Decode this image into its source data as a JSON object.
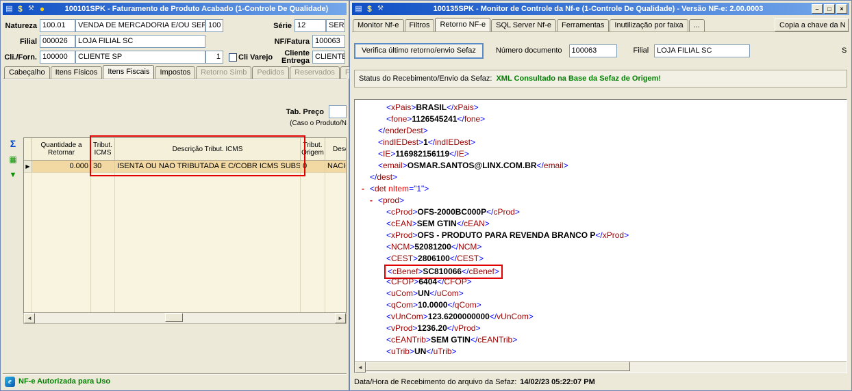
{
  "colors": {
    "titlebar_gradient_start": "#0f4fc4",
    "titlebar_gradient_end": "#74a7ea",
    "success_green": "#008000",
    "highlight_red": "#e30000",
    "xml_bracket_blue": "#0000ff",
    "xml_tag_maroon": "#990000",
    "xml_attr_red": "#ff0000",
    "grid_cream": "#f8f4df",
    "selected_row_tan": "#f2d9a4"
  },
  "left_window": {
    "title": "100101SPK - Faturamento de Produto Acabado (1-Controle De Qualidade)",
    "titlebar_icons": [
      {
        "name": "form-icon",
        "glyph": "▤"
      },
      {
        "name": "money-icon",
        "glyph": "$"
      },
      {
        "name": "wrench-icon",
        "glyph": "⚒"
      },
      {
        "name": "user-icon",
        "glyph": "●"
      }
    ],
    "form": {
      "natureza_label": "Natureza",
      "natureza_code": "100.01",
      "natureza_desc": "VENDA DE MERCADORIA E/OU SERVI",
      "natureza_extra": "100",
      "serie_label": "Série",
      "serie_value": "12",
      "serie_extra": "SERI",
      "filial_label": "Filial",
      "filial_code": "000026",
      "filial_desc": "LOJA FILIAL SC",
      "nf_fatura_label": "NF/Fatura",
      "nf_fatura_value": "100063",
      "cli_forn_label": "Cli./Forn.",
      "cli_forn_code": "100000",
      "cli_forn_desc": "CLIENTE SP",
      "cli_forn_extra": "1",
      "cli_varejo_label": "Cli Varejo",
      "cliente_entrega_label": "Cliente Entrega",
      "cliente_entrega_value": "CLIENTE"
    },
    "tabs": [
      {
        "label": "Cabeçalho",
        "state": "normal"
      },
      {
        "label": "Itens Físicos",
        "state": "normal"
      },
      {
        "label": "Itens Fiscais",
        "state": "active"
      },
      {
        "label": "Impostos",
        "state": "normal"
      },
      {
        "label": "Retorno Simb",
        "state": "disabled"
      },
      {
        "label": "Pedidos",
        "state": "disabled"
      },
      {
        "label": "Reservados",
        "state": "disabled"
      },
      {
        "label": "Financ",
        "state": "disabled"
      }
    ],
    "tab_preco_label": "Tab. Preço",
    "tab_preco_value": "",
    "tab_preco_note": "(Caso o Produto/N",
    "side_icons": [
      {
        "name": "sum-icon",
        "glyph": "Σ"
      },
      {
        "name": "export-grid-icon",
        "glyph": "▦"
      },
      {
        "name": "export-down-icon",
        "glyph": "▼"
      }
    ],
    "grid": {
      "columns": [
        "",
        "Quantidade a Retornar",
        "Tribut. ICMS",
        "Descrição Tribut. ICMS",
        "Tribut. Origem",
        "Descriçã"
      ],
      "row_marker": "▶",
      "row": [
        "0.000",
        "30",
        "ISENTA OU NAO TRIBUTADA E C/COBR ICMS SUBS",
        "0",
        "NACION"
      ]
    },
    "scrollbar": {
      "left_glyph": "◄",
      "right_glyph": "►"
    },
    "statusbar": {
      "icon": {
        "name": "nfe-icon",
        "glyph": "e"
      },
      "text": "NF-e Autorizada para Uso"
    }
  },
  "right_window": {
    "title": "100135SPK - Monitor de Controle da Nf-e (1-Controle De Qualidade) - Versão NF-e: 2.00.0003",
    "titlebar_icons": [
      {
        "name": "form-icon",
        "glyph": "▤"
      },
      {
        "name": "money-icon",
        "glyph": "$"
      },
      {
        "name": "wrench-icon",
        "glyph": "⚒"
      }
    ],
    "window_buttons": [
      {
        "name": "minimize-button",
        "glyph": "–"
      },
      {
        "name": "maximize-button",
        "glyph": "□"
      },
      {
        "name": "close-button",
        "glyph": "×"
      }
    ],
    "tabs": [
      {
        "label": "Monitor Nf-e",
        "state": "normal"
      },
      {
        "label": "Filtros",
        "state": "normal"
      },
      {
        "label": "Retorno NF-e",
        "state": "active"
      },
      {
        "label": "SQL Server Nf-e",
        "state": "normal"
      },
      {
        "label": "Ferramentas",
        "state": "normal"
      },
      {
        "label": "Inutilização por faixa",
        "state": "normal"
      },
      {
        "label": "...",
        "state": "normal"
      }
    ],
    "copy_key_button": "Copia a chave da N",
    "toolbar": {
      "verify_button": "Verifica último retorno/envio Sefaz",
      "doc_label": "Número documento",
      "doc_value": "100063",
      "filial_label": "Filial",
      "filial_value": "LOJA FILIAL SC",
      "truncated_label": "S"
    },
    "sefaz_status": {
      "label": "Status do Recebimento/Envio da Sefaz:",
      "value": "XML Consultado na Base da Sefaz de Origem!"
    },
    "xml_lines": [
      {
        "i": 3,
        "t": "elem",
        "tag": "xPais",
        "val": "BRASIL"
      },
      {
        "i": 3,
        "t": "elem",
        "tag": "fone",
        "val": "1126545241"
      },
      {
        "i": 2,
        "t": "close",
        "tag": "enderDest"
      },
      {
        "i": 2,
        "t": "elem",
        "tag": "indIEDest",
        "val": "1"
      },
      {
        "i": 2,
        "t": "elem",
        "tag": "IE",
        "val": "116982156119"
      },
      {
        "i": 2,
        "t": "elem",
        "tag": "email",
        "val": "OSMAR.SANTOS@LINX.COM.BR"
      },
      {
        "i": 1,
        "t": "close",
        "tag": "dest"
      },
      {
        "i": 1,
        "t": "open",
        "tag": "det",
        "marker": true,
        "attr": "nItem",
        "attrval": "1"
      },
      {
        "i": 2,
        "t": "open",
        "tag": "prod",
        "marker": true
      },
      {
        "i": 3,
        "t": "elem",
        "tag": "cProd",
        "val": "OFS-2000BC000P"
      },
      {
        "i": 3,
        "t": "elem",
        "tag": "cEAN",
        "val": "SEM GTIN"
      },
      {
        "i": 3,
        "t": "elem",
        "tag": "xProd",
        "val": "OFS - PRODUTO PARA REVENDA BRANCO P"
      },
      {
        "i": 3,
        "t": "elem",
        "tag": "NCM",
        "val": "52081200"
      },
      {
        "i": 3,
        "t": "elem",
        "tag": "CEST",
        "val": "2806100"
      },
      {
        "i": 3,
        "t": "elem",
        "tag": "cBenef",
        "val": "SC810066",
        "highlight": true
      },
      {
        "i": 3,
        "t": "elem",
        "tag": "CFOP",
        "val": "6404"
      },
      {
        "i": 3,
        "t": "elem",
        "tag": "uCom",
        "val": "UN"
      },
      {
        "i": 3,
        "t": "elem",
        "tag": "qCom",
        "val": "10.0000"
      },
      {
        "i": 3,
        "t": "elem",
        "tag": "vUnCom",
        "val": "123.6200000000"
      },
      {
        "i": 3,
        "t": "elem",
        "tag": "vProd",
        "val": "1236.20"
      },
      {
        "i": 3,
        "t": "elem",
        "tag": "cEANTrib",
        "val": "SEM GTIN"
      },
      {
        "i": 3,
        "t": "elem",
        "tag": "uTrib",
        "val": "UN"
      }
    ],
    "xml_scroll_left_glyph": "◄",
    "footer": {
      "label": "Data/Hora de Recebimento do arquivo da Sefaz:",
      "value": "14/02/23 05:22:07 PM"
    }
  }
}
